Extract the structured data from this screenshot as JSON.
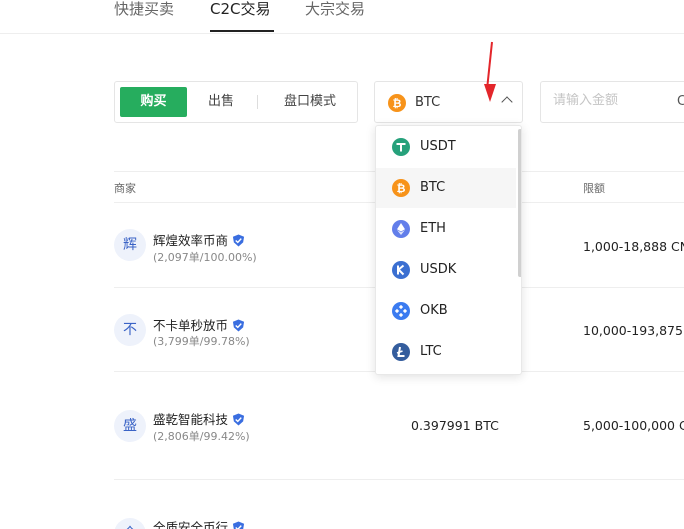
{
  "nav": {
    "tabs": [
      {
        "label": "快捷买卖"
      },
      {
        "label": "C2C交易"
      },
      {
        "label": "大宗交易"
      }
    ],
    "active": "C2C交易"
  },
  "trade_mode": {
    "buy": "购买",
    "sell": "出售",
    "block": "盘口模式"
  },
  "coin_select": {
    "selected": "BTC"
  },
  "amount": {
    "placeholder": "请输入金额",
    "currency": "C"
  },
  "dropdown": {
    "items": [
      {
        "label": "USDT",
        "icon": "usdt-icon",
        "color": "#26a17b"
      },
      {
        "label": "BTC",
        "icon": "btc-icon",
        "color": "#f7931a"
      },
      {
        "label": "ETH",
        "icon": "eth-icon",
        "color": "#627eea"
      },
      {
        "label": "USDK",
        "icon": "usdk-icon",
        "color": "#3b6fd1"
      },
      {
        "label": "OKB",
        "icon": "okb-icon",
        "color": "#3b7bf0"
      },
      {
        "label": "LTC",
        "icon": "ltc-icon",
        "color": "#345d9d"
      }
    ]
  },
  "table": {
    "headers": {
      "merchant": "商家",
      "limit": "限额"
    },
    "rows": [
      {
        "avatar": "辉",
        "name": "辉煌效率币商",
        "stats": "(2,097单/100.00%)",
        "price": "",
        "limit": "1,000-18,888 CN"
      },
      {
        "avatar": "不",
        "name": "不卡单秒放币",
        "stats": "(3,799单/99.78%)",
        "price": "",
        "limit": "10,000-193,875."
      },
      {
        "avatar": "盛",
        "name": "盛乾智能科技",
        "stats": "(2,806单/99.42%)",
        "price": "0.397991 BTC",
        "limit": "5,000-100,000 C"
      },
      {
        "avatar": "全",
        "name": "全质安全币行",
        "stats": "",
        "price": "",
        "limit": ""
      }
    ]
  },
  "colors": {
    "buy_green": "#26ad5e",
    "verified_blue": "#3a6ee0",
    "annotation_red": "#e3262b"
  }
}
